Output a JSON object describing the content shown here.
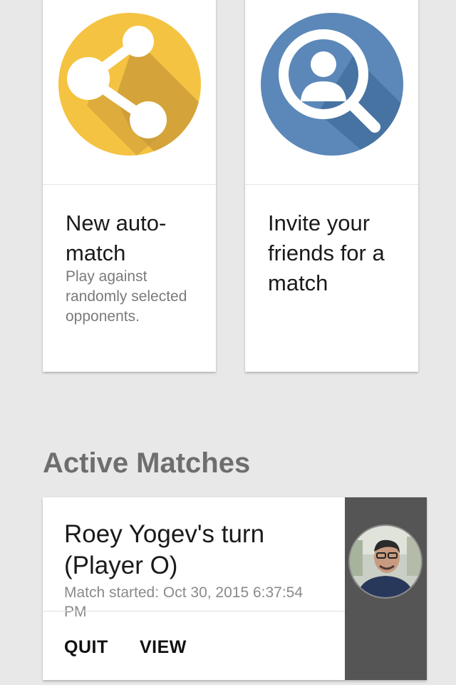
{
  "cards": [
    {
      "title": "New auto-match",
      "description": "Play against randomly selected opponents.",
      "icon": "share-icon",
      "icon_color": "#f5c342"
    },
    {
      "title": "Invite your friends for a match",
      "description": "",
      "icon": "search-person-icon",
      "icon_color": "#5b88b8"
    }
  ],
  "active_matches": {
    "heading": "Active Matches",
    "items": [
      {
        "title": "Roey Yogev's turn (Player O)",
        "started": "Match started: Oct 30, 2015 6:37:54 PM",
        "quit_label": "QUIT",
        "view_label": "VIEW",
        "avatar": "player-avatar"
      }
    ]
  },
  "colors": {
    "background": "#e8e8e8",
    "card": "#ffffff",
    "avatar_panel": "#555555",
    "heading": "#6e6e6e"
  }
}
